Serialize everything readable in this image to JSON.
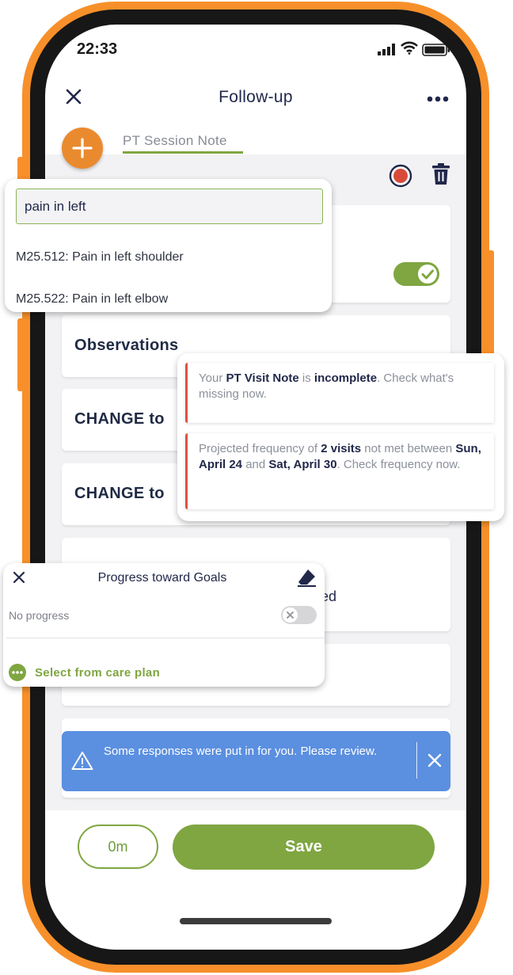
{
  "status": {
    "time": "22:33"
  },
  "nav": {
    "title": "Follow-up"
  },
  "tab": {
    "label": "PT Session Note"
  },
  "cards": {
    "observations": "Observations",
    "change1": "CHANGE to",
    "change2": "CHANGE to",
    "partial_suffix": "ed"
  },
  "search": {
    "value": "pain in left",
    "results": [
      "M25.512: Pain in left shoulder",
      "M25.522: Pain in left elbow"
    ]
  },
  "notifications": {
    "n1": {
      "p1": "Your ",
      "b1": "PT Visit Note",
      "p2": " is ",
      "b2": "incomplete",
      "p3": ". Check what's missing now."
    },
    "n2": {
      "p1": "Projected frequency of ",
      "b1": "2 visits",
      "p2": " not met between ",
      "b2": "Sun, April 24",
      "p3": " and ",
      "b3": "Sat, April 30",
      "p4": ". Check frequency now."
    }
  },
  "goals": {
    "title": "Progress toward Goals",
    "progress_label": "No progress",
    "select_label": "Select from care plan"
  },
  "banner": {
    "message": "Some responses were put in for you. Please review."
  },
  "footer": {
    "timer": "0m",
    "save": "Save"
  },
  "colors": {
    "accent_orange": "#f7902a",
    "green": "#7fa641",
    "banner_blue": "#5b8fe0",
    "record_red": "#d84b3a",
    "navy": "#21284a"
  },
  "icons": [
    "close-icon",
    "more-icon",
    "add-icon",
    "record-icon",
    "trash-icon",
    "check-icon",
    "eraser-icon",
    "alert-icon",
    "ellipsis-icon"
  ]
}
